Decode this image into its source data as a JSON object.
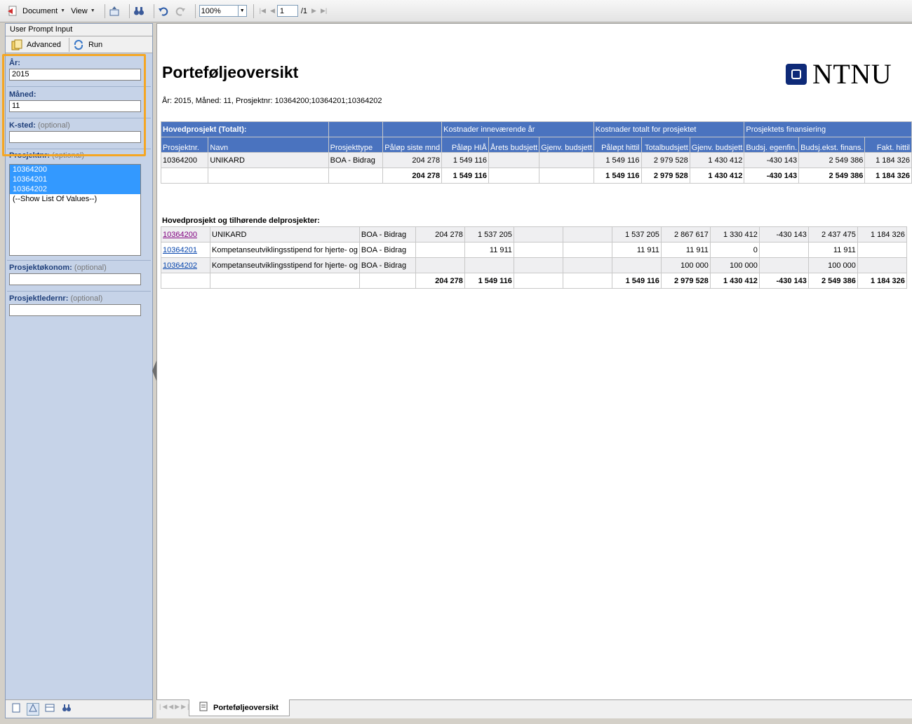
{
  "toolbar": {
    "document_label": "Document",
    "view_label": "View",
    "zoom": "100%",
    "page_current": "1",
    "page_total": "/1"
  },
  "left_panel": {
    "title": "User Prompt Input",
    "advanced_label": "Advanced",
    "run_label": "Run",
    "fields": {
      "ar": {
        "label": "År:",
        "value": "2015"
      },
      "maned": {
        "label": "Måned:",
        "value": "11"
      },
      "ksted": {
        "label": "K-sted:",
        "optional": "(optional)",
        "value": ""
      },
      "prosjektnr": {
        "label": "Prosjektnr:",
        "optional": "(optional)"
      },
      "prosjektokonom": {
        "label": "Prosjektøkonom:",
        "optional": "(optional)",
        "value": ""
      },
      "prosjektledernr": {
        "label": "Prosjektledernr:",
        "optional": "(optional)",
        "value": ""
      }
    },
    "list_items": [
      "10364200",
      "10364201",
      "10364202",
      "(--Show List Of Values--)"
    ]
  },
  "report": {
    "title": "Porteføljeoversikt",
    "subtitle": "År: 2015, Måned: 11, Prosjektnr: 10364200;10364201;10364202",
    "logo_text": "NTNU",
    "table1": {
      "group_headers": [
        "Hovedprosjekt (Totalt):",
        "Kostnader inneværende år",
        "Kostnader totalt for prosjektet",
        "Prosjektets finansiering"
      ],
      "columns": [
        "Prosjektnr.",
        "Navn",
        "Prosjekttype",
        "Påløp siste mnd",
        "Påløp HIÅ",
        "Årets budsjett",
        "Gjenv. budsjett",
        "Påløpt hittil",
        "Totalbudsjett",
        "Gjenv. budsjett",
        "Budsj. egenfin.",
        "Budsj.ekst. finans.",
        "Fakt. hittil"
      ],
      "rows": [
        [
          "10364200",
          "UNIKARD",
          "BOA - Bidrag",
          "204 278",
          "1 549 116",
          "",
          "",
          "1 549 116",
          "2 979 528",
          "1 430 412",
          "-430 143",
          "2 549 386",
          "1 184 326"
        ]
      ],
      "total": [
        "",
        "",
        "",
        "204 278",
        "1 549 116",
        "",
        "",
        "1 549 116",
        "2 979 528",
        "1 430 412",
        "-430 143",
        "2 549 386",
        "1 184 326"
      ]
    },
    "section2_title": "Hovedprosjekt og  tilhørende delprosjekter:",
    "table2": {
      "rows": [
        [
          "10364200",
          "UNIKARD",
          "BOA - Bidrag",
          "204 278",
          "1 537 205",
          "",
          "",
          "1 537 205",
          "2 867 617",
          "1 330 412",
          "-430 143",
          "2 437 475",
          "1 184 326"
        ],
        [
          "10364201",
          "Kompetanseutviklingsstipend for hjerte- og",
          "BOA - Bidrag",
          "",
          "11 911",
          "",
          "",
          "11 911",
          "11 911",
          "0",
          "",
          "11 911",
          ""
        ],
        [
          "10364202",
          "Kompetanseutviklingsstipend for hjerte- og",
          "BOA - Bidrag",
          "",
          "",
          "",
          "",
          "",
          "100 000",
          "100 000",
          "",
          "100 000",
          ""
        ]
      ],
      "total": [
        "",
        "",
        "",
        "204 278",
        "1 549 116",
        "",
        "",
        "1 549 116",
        "2 979 528",
        "1 430 412",
        "-430 143",
        "2 549 386",
        "1 184 326"
      ]
    },
    "tab_label": "Porteføljeoversikt"
  }
}
